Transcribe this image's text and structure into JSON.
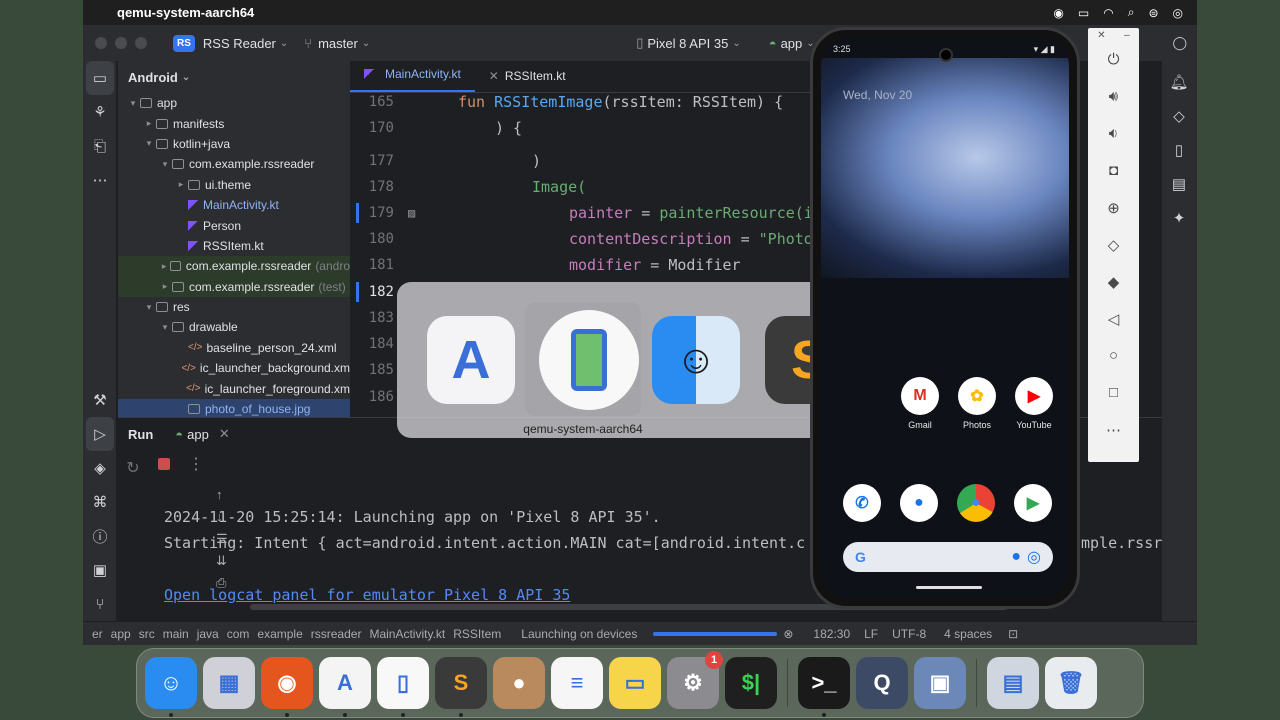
{
  "menubar": {
    "app_name": "qemu-system-aarch64"
  },
  "toolbar": {
    "project_badge": "RS",
    "project_name": "RSS Reader",
    "branch": "master",
    "device": "Pixel 8 API 35",
    "run_config": "app"
  },
  "project_panel": {
    "view": "Android",
    "tree": [
      {
        "label": "app",
        "indent": 0,
        "arrow": "▾",
        "icon": "folder"
      },
      {
        "label": "manifests",
        "indent": 1,
        "arrow": "▸",
        "icon": "folder"
      },
      {
        "label": "kotlin+java",
        "indent": 1,
        "arrow": "▾",
        "icon": "folder"
      },
      {
        "label": "com.example.rssreader",
        "indent": 2,
        "arrow": "▾",
        "icon": "folder"
      },
      {
        "label": "ui.theme",
        "indent": 3,
        "arrow": "▸",
        "icon": "folder"
      },
      {
        "label": "MainActivity.kt",
        "indent": 3,
        "arrow": "",
        "icon": "kotlin",
        "highlight": "blue"
      },
      {
        "label": "Person",
        "indent": 3,
        "arrow": "",
        "icon": "kotlin"
      },
      {
        "label": "RSSItem.kt",
        "indent": 3,
        "arrow": "",
        "icon": "kotlin"
      },
      {
        "label": "com.example.rssreader",
        "suffix": "(andro",
        "indent": 2,
        "arrow": "▸",
        "icon": "folder",
        "highlight": "green"
      },
      {
        "label": "com.example.rssreader",
        "suffix": "(test)",
        "indent": 2,
        "arrow": "▸",
        "icon": "folder",
        "highlight": "green"
      },
      {
        "label": "res",
        "indent": 1,
        "arrow": "▾",
        "icon": "folder"
      },
      {
        "label": "drawable",
        "indent": 2,
        "arrow": "▾",
        "icon": "folder"
      },
      {
        "label": "baseline_person_24.xml",
        "indent": 3,
        "arrow": "",
        "icon": "xml"
      },
      {
        "label": "ic_launcher_background.xm",
        "indent": 3,
        "arrow": "",
        "icon": "xml"
      },
      {
        "label": "ic_launcher_foreground.xm",
        "indent": 3,
        "arrow": "",
        "icon": "xml"
      },
      {
        "label": "photo_of_house.jpg",
        "indent": 3,
        "arrow": "",
        "icon": "img",
        "highlight": "selected"
      }
    ]
  },
  "editor": {
    "tabs": [
      {
        "label": "MainActivity.kt",
        "active": true
      },
      {
        "label": "RSSItem.kt",
        "active": false
      }
    ],
    "lines": [
      {
        "num": "165",
        "indent": 0,
        "html_tokens": [
          [
            "kw",
            "fun "
          ],
          [
            "fn",
            "RSSItemImage"
          ],
          [
            "",
            "("
          ],
          [
            "",
            "rssItem: RSSItem) {"
          ]
        ]
      },
      {
        "num": "170",
        "indent": 1,
        "html_tokens": [
          [
            "",
            ") {"
          ]
        ]
      },
      {
        "num": "177",
        "indent": 2,
        "html_tokens": [
          [
            "",
            ")"
          ]
        ]
      },
      {
        "num": "178",
        "indent": 2,
        "html_tokens": [
          [
            "str2",
            "Image("
          ]
        ]
      },
      {
        "num": "179",
        "indent": 3,
        "html_tokens": [
          [
            "param",
            "painter"
          ],
          [
            "",
            " = "
          ],
          [
            "str2",
            "painterResource(i"
          ]
        ]
      },
      {
        "num": "180",
        "indent": 3,
        "html_tokens": [
          [
            "param",
            "contentDescription"
          ],
          [
            "",
            " = "
          ],
          [
            "str",
            "\"Photo"
          ]
        ]
      },
      {
        "num": "181",
        "indent": 3,
        "html_tokens": [
          [
            "param",
            "modifier"
          ],
          [
            "",
            " = Modifier"
          ]
        ]
      },
      {
        "num": "182",
        "indent": 0,
        "html_tokens": []
      },
      {
        "num": "183",
        "indent": 0,
        "html_tokens": []
      },
      {
        "num": "184",
        "indent": 0,
        "html_tokens": []
      },
      {
        "num": "185",
        "indent": 0,
        "html_tokens": []
      },
      {
        "num": "186",
        "indent": 0,
        "html_tokens": []
      }
    ],
    "current_line": "182"
  },
  "run_panel": {
    "title": "Run",
    "tab": "app",
    "console": [
      "2024-11-20 15:25:14: Launching app on 'Pixel 8 API 35'.",
      "Starting: Intent { act=android.intent.action.MAIN cat=[android.intent.c",
      "mple.rssr"
    ],
    "link": "Open logcat panel for emulator Pixel 8 API 35"
  },
  "statusbar": {
    "crumbs": [
      "er",
      "app",
      "src",
      "main",
      "java",
      "com",
      "example",
      "rssreader",
      "MainActivity.kt",
      "RSSItem"
    ],
    "task": "Launching on devices",
    "position": "182:30",
    "line_sep": "LF",
    "encoding": "UTF-8",
    "indent": "4 spaces"
  },
  "app_switcher": {
    "label": "qemu-system-aarch64",
    "apps": [
      "android-studio-icon",
      "emulator-icon",
      "finder-icon",
      "sublime-icon"
    ]
  },
  "phone": {
    "status_time": "3:25",
    "date": "Wed, Nov 20",
    "row1": [
      {
        "name": "Gmail",
        "icon": "gmail-icon"
      },
      {
        "name": "Photos",
        "icon": "photos-icon"
      },
      {
        "name": "YouTube",
        "icon": "youtube-icon"
      }
    ],
    "dock": [
      "phone-icon",
      "messages-icon",
      "chrome-icon",
      "play-store-icon"
    ],
    "search_g": "G"
  },
  "dock": {
    "apps": [
      {
        "name": "finder",
        "color": "#2a8cf0",
        "glyph": "☺",
        "running": true
      },
      {
        "name": "launchpad",
        "color": "#d0d0d8",
        "glyph": "▦",
        "running": false
      },
      {
        "name": "firefox",
        "color": "#e5561e",
        "glyph": "◉",
        "running": true
      },
      {
        "name": "android-studio",
        "color": "#f4f4f4",
        "glyph": "A",
        "running": true
      },
      {
        "name": "emulator",
        "color": "#f8f8f8",
        "glyph": "▯",
        "running": true
      },
      {
        "name": "sublime",
        "color": "#3a3a3a",
        "glyph": "S",
        "running": true
      },
      {
        "name": "contacts",
        "color": "#b98a5e",
        "glyph": "●",
        "running": false
      },
      {
        "name": "reminders",
        "color": "#f6f6f6",
        "glyph": "≡",
        "running": false
      },
      {
        "name": "notes",
        "color": "#f7d54a",
        "glyph": "▭",
        "running": false
      },
      {
        "name": "system-settings",
        "color": "#8c8c90",
        "glyph": "⚙",
        "running": false,
        "badge": "1"
      },
      {
        "name": "console",
        "color": "#1f1f1f",
        "glyph": "$|",
        "running": false
      },
      {
        "name": "terminal",
        "color": "#1a1a1a",
        "glyph": ">_",
        "running": true
      },
      {
        "name": "quicktime",
        "color": "#3d4a66",
        "glyph": "Q",
        "running": false
      },
      {
        "name": "preview",
        "color": "#6b88b8",
        "glyph": "▣",
        "running": false
      },
      {
        "name": "photos-folder",
        "color": "#cfd6e0",
        "glyph": "▤",
        "running": false
      },
      {
        "name": "trash",
        "color": "#e9ecef",
        "glyph": "🗑",
        "running": false
      }
    ]
  }
}
